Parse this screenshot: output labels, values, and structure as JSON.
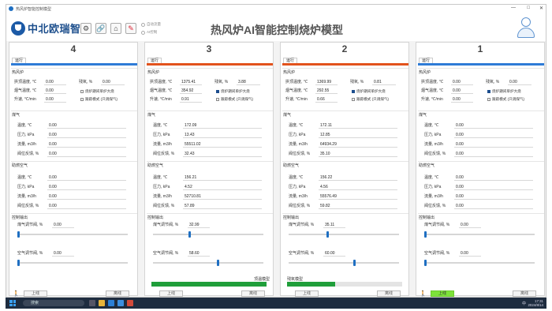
{
  "window": {
    "title": "热风炉智能控制模型",
    "controls": [
      "—",
      "□",
      "✕"
    ]
  },
  "header": {
    "logo_text": "中北欧瑞智",
    "app_title": "热风炉AI智能控制烧炉模型",
    "radio_options": [
      "自动流量",
      "AI控制"
    ],
    "toolbar_icons": [
      "gear-icon",
      "link-icon",
      "home-icon",
      "edit-icon"
    ]
  },
  "labels": {
    "run_tab": "运行",
    "section_furnace": "热风炉",
    "dome_temp": "拱顶温度, ℃",
    "flue_temp": "烟气温度, ℃",
    "rise_rate": "升速, ℃/min",
    "residual_o2": "残氧, %",
    "chk_air_first": "烧炉期间单炉大烧",
    "chk_follow": "跟踪模式 (只调煤气)",
    "section_gas": "煤气",
    "temp": "温度, ℃",
    "pressure": "压力, kPa",
    "flow": "流量, m3/h",
    "valve_fb": "阀位反馈, %",
    "section_air": "助燃空气",
    "section_out": "控制输出",
    "gas_valve": "煤气调节阀, %",
    "air_valve": "空气调节阀, %",
    "btn_online": "上线",
    "btn_offline": "离线"
  },
  "panels": [
    {
      "num": "4",
      "run_color": "#2e7bd6",
      "dome": "0.00",
      "flue": "0.00",
      "rise": "0.00",
      "o2": "0.00",
      "gas": {
        "temp": "0.00",
        "press": "0.00",
        "flow": "0.00",
        "valve": "0.00"
      },
      "air": {
        "temp": "0.00",
        "press": "0.00",
        "flow": "0.00",
        "valve": "0.00"
      },
      "out": {
        "gas": "0.00",
        "air": "0.00",
        "gas_level": 0.0,
        "air_level": 0.0
      },
      "chk_air_first": false,
      "chk_follow": false,
      "model": "",
      "model_level": 0,
      "online_active": false,
      "walk_icon": true
    },
    {
      "num": "3",
      "run_color": "#e2521c",
      "dome": "1375.41",
      "flue": "354.92",
      "rise": "0.91",
      "o2": "3.88",
      "gas": {
        "temp": "172.09",
        "press": "13.43",
        "flow": "55511.02",
        "valve": "32.43"
      },
      "air": {
        "temp": "156.21",
        "press": "4.52",
        "flow": "52710.81",
        "valve": "57.89"
      },
      "out": {
        "gas": "32.99",
        "air": "58.60",
        "gas_level": 0.33,
        "air_level": 0.59
      },
      "chk_air_first": true,
      "chk_follow": false,
      "model": "顶温模型",
      "model_level": 1.0,
      "online_active": false,
      "walk_icon": false
    },
    {
      "num": "2",
      "run_color": "#e2521c",
      "dome": "1369.99",
      "flue": "292.55",
      "rise": "0.66",
      "o2": "0.81",
      "gas": {
        "temp": "172.11",
        "press": "12.85",
        "flow": "64934.29",
        "valve": "35.10"
      },
      "air": {
        "temp": "156.22",
        "press": "4.56",
        "flow": "55576.49",
        "valve": "59.82"
      },
      "out": {
        "gas": "35.11",
        "air": "60.00",
        "gas_level": 0.35,
        "air_level": 0.6
      },
      "chk_air_first": true,
      "chk_follow": false,
      "model": "残氧模型",
      "model_level": 0.42,
      "online_active": false,
      "walk_icon": false
    },
    {
      "num": "1",
      "run_color": "#2e7bd6",
      "dome": "0.00",
      "flue": "0.00",
      "rise": "0.00",
      "o2": "0.00",
      "gas": {
        "temp": "0.00",
        "press": "0.00",
        "flow": "0.00",
        "valve": "0.00"
      },
      "air": {
        "temp": "0.00",
        "press": "0.00",
        "flow": "0.00",
        "valve": "0.00"
      },
      "out": {
        "gas": "0.00",
        "air": "0.00",
        "gas_level": 0.0,
        "air_level": 0.0
      },
      "chk_air_first": true,
      "chk_follow": false,
      "model": "",
      "model_level": 0,
      "online_active": true,
      "walk_icon": true
    }
  ],
  "taskbar": {
    "search_placeholder": "搜索",
    "time": "17:31",
    "date": "2024/8/14",
    "sys_text": "中"
  }
}
